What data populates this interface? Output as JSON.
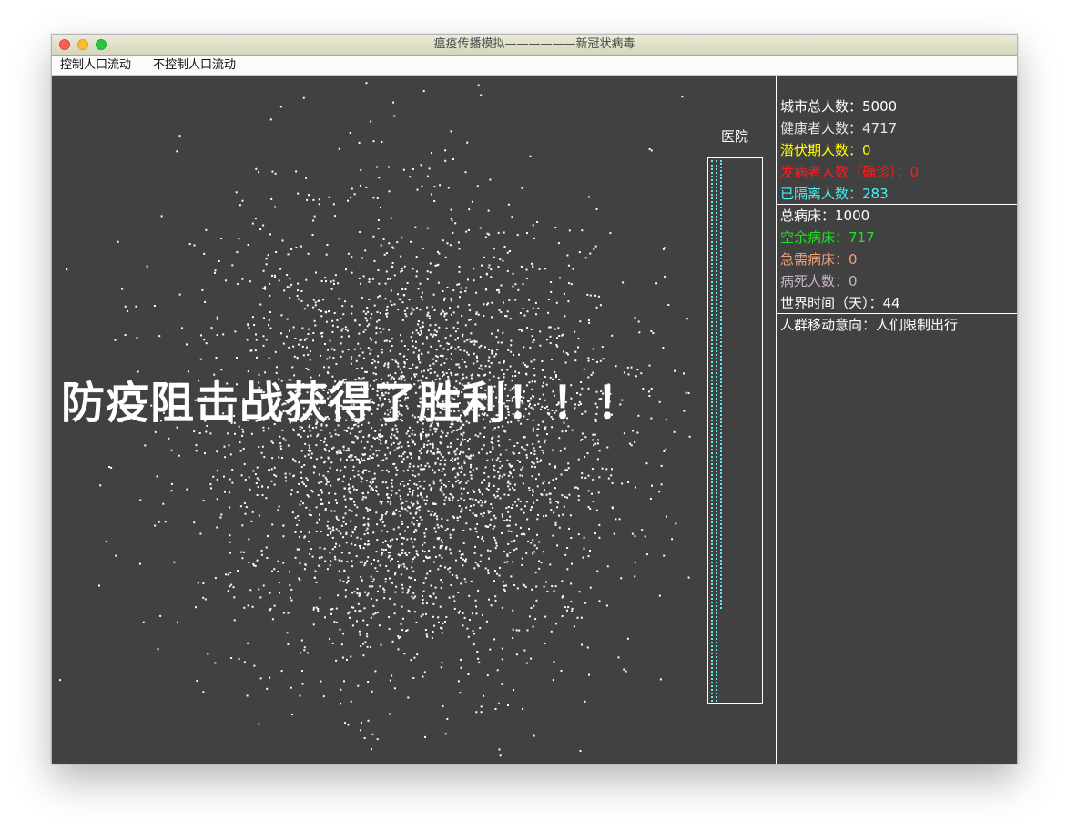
{
  "window": {
    "title": "瘟疫传播模拟——————新冠状病毒"
  },
  "menu": {
    "items": [
      "控制人口流动",
      "不控制人口流动"
    ]
  },
  "simulation": {
    "banner": "防疫阻击战获得了胜利！！！",
    "hospital_label": "医院",
    "dot_color": "#ffffff",
    "bed_color": "#68e8e8"
  },
  "stats": {
    "total": {
      "label": "城市总人数：",
      "value": "5000",
      "color": "#ffffff"
    },
    "healthy": {
      "label": "健康者人数：",
      "value": "4717",
      "color": "#e6e6e6"
    },
    "latent": {
      "label": "潜伏期人数：",
      "value": "0",
      "color": "#ffff00"
    },
    "confirmed": {
      "label": "发病者人数（确诊）：",
      "value": "0",
      "color": "#ff1a1a"
    },
    "isolated": {
      "label": "已隔离人数：",
      "value": "283",
      "color": "#48f0f0"
    },
    "beds_total": {
      "label": "总病床：",
      "value": "1000",
      "color": "#ffffff"
    },
    "beds_free": {
      "label": "空余病床：",
      "value": "717",
      "color": "#22e022"
    },
    "beds_needed": {
      "label": "急需病床：",
      "value": "0",
      "color": "#f0a080"
    },
    "deaths": {
      "label": "病死人数：",
      "value": "0",
      "color": "#c8b4c8"
    },
    "world_time": {
      "label": "世界时间（天）：",
      "value": "44",
      "color": "#ffffff"
    },
    "movement": {
      "label": "人群移动意向：",
      "value": "人们限制出行",
      "color": "#ffffff"
    }
  }
}
